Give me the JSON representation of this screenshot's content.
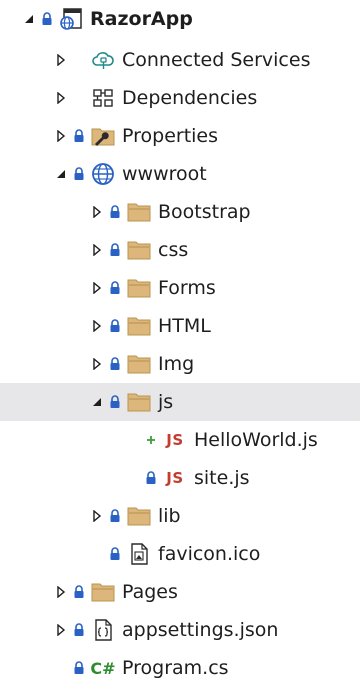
{
  "solution_explorer": {
    "project": {
      "label": "RazorApp"
    },
    "items": [
      {
        "label": "Connected Services"
      },
      {
        "label": "Dependencies"
      },
      {
        "label": "Properties"
      },
      {
        "label": "wwwroot"
      },
      {
        "label": "Bootstrap"
      },
      {
        "label": "css"
      },
      {
        "label": "Forms"
      },
      {
        "label": "HTML"
      },
      {
        "label": "Img"
      },
      {
        "label": "js"
      },
      {
        "label": "HelloWorld.js",
        "badge": "JS"
      },
      {
        "label": "site.js",
        "badge": "JS"
      },
      {
        "label": "lib"
      },
      {
        "label": "favicon.ico"
      },
      {
        "label": "Pages"
      },
      {
        "label": "appsettings.json"
      },
      {
        "label": "Program.cs",
        "badge": "C#"
      }
    ]
  },
  "colors": {
    "lock": "#2962c4",
    "folder": "#dcb67a",
    "selection": "#e7e7e9",
    "js_badge": "#c33d2e",
    "cs_badge": "#2e8b2e",
    "added": "#3f9f3f"
  }
}
